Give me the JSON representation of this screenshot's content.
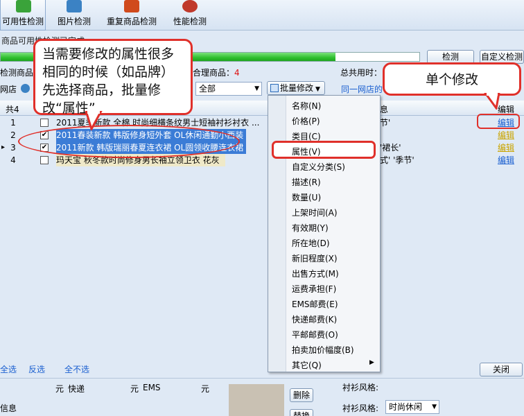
{
  "toolbar": {
    "items": [
      {
        "label": "可用性检测",
        "icon": "check-icon",
        "color": "#3aa33a"
      },
      {
        "label": "图片检测",
        "icon": "image-icon",
        "color": "#3b82c4"
      },
      {
        "label": "重复商品检测",
        "icon": "duplicate-icon",
        "color": "#d04a1c"
      },
      {
        "label": "性能检测",
        "icon": "performance-icon",
        "color": "#c0392b"
      }
    ]
  },
  "status": {
    "text": "商品可用性检测已完成",
    "progress_fraction": 0.8
  },
  "buttons": {
    "detect": "检测",
    "custom_detect": "自定义检测",
    "close": "关闭",
    "delete": "删除",
    "replace": "替换"
  },
  "filters": {
    "detected_label": "检测商品",
    "shop_label": "网店",
    "unreasonable_label": "合理商品：",
    "unreasonable_count": "4",
    "total_time_label": "总共用时：",
    "category_value": "全部",
    "batch_edit_label": "批量修改",
    "same_shop_link": "同一网店的"
  },
  "grid": {
    "total_label": "共4",
    "info_header": "息",
    "edit_header": "编辑",
    "rows": [
      {
        "num": "1",
        "idx": "",
        "checked": false,
        "title": "2011夏季新款 全棉 时尚细横条纹男士短袖衬衫衬衣 ...",
        "info": "节'",
        "edit": "编辑",
        "style": "normal"
      },
      {
        "num": "2",
        "idx": "",
        "checked": true,
        "title": "2011春装新款 韩版修身短外套 OL休闲通勤小西装",
        "info": "",
        "edit": "编辑",
        "style": "selected"
      },
      {
        "num": "3",
        "idx": "▸",
        "checked": true,
        "title": "2011新款 韩版瑞丽春夏连衣裙 OL圆领收腰连衣裙",
        "info": "'裙长'",
        "edit": "编辑",
        "style": "selected"
      },
      {
        "num": "4",
        "idx": "",
        "checked": false,
        "title": "玛天宝 秋冬款时尚修身男长袖立领卫衣 花灰",
        "info": "式'  '季节'",
        "edit": "编辑",
        "style": "yellow"
      }
    ]
  },
  "menu": {
    "items": [
      "名称(N)",
      "价格(P)",
      "类目(C)",
      "属性(V)",
      "自定义分类(S)",
      "描述(R)",
      "数量(U)",
      "上架时间(A)",
      "有效期(Y)",
      "所在地(D)",
      "新旧程度(X)",
      "出售方式(M)",
      "运费承担(F)",
      "EMS邮费(E)",
      "快递邮费(K)",
      "平邮邮费(O)",
      "拍卖加价幅度(B)",
      "其它(Q)"
    ],
    "highlighted": "属性(V)"
  },
  "bottom_links": {
    "select_all": "全选",
    "invert": "反选",
    "select_none": "全不选"
  },
  "bottom_form": {
    "yuan1": "元",
    "express_label": "快递",
    "yuan2": "元",
    "ems_label": "EMS",
    "yuan3": "元",
    "info_label": "信息",
    "shirt_style_label": "衬衫风格:",
    "shirt_style_value": "时尚休闲",
    "shirt_style_top_label": "衬衫风格:"
  },
  "callouts": {
    "left": "当需要修改的属性很多相同的时候（如品牌）先选择商品，批量修改“属性”",
    "right": "单个修改"
  },
  "colors": {
    "highlight_red": "#e0302a",
    "selected_row": "#3b7cd6",
    "link_blue": "#1a5fd0",
    "progress_green": "#2fbf2f"
  }
}
